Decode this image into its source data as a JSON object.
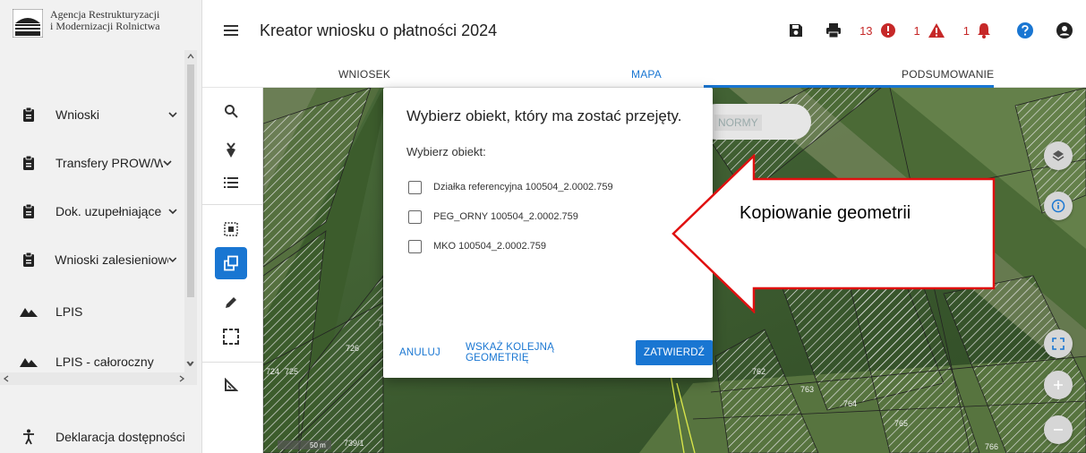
{
  "org": {
    "line1": "Agencja Restrukturyzacji",
    "line2": "i Modernizacji Rolnictwa",
    "badge": "ARiMR"
  },
  "sidebar": {
    "items": [
      {
        "label": "Wnioski",
        "icon": "clipboard-icon",
        "chevron": true
      },
      {
        "label": "Transfery PROW/WPR",
        "icon": "clipboard-icon",
        "chevron": true
      },
      {
        "label": "Dok. uzupełniające",
        "icon": "clipboard-icon",
        "chevron": true
      },
      {
        "label": "Wnioski zalesieniowe",
        "icon": "clipboard-icon",
        "chevron": true
      },
      {
        "label": "LPIS",
        "icon": "terrain-icon",
        "chevron": false
      },
      {
        "label": "LPIS - całoroczny",
        "icon": "terrain-icon",
        "chevron": false
      },
      {
        "label": "Deklaracja dostępności",
        "icon": "accessibility-icon",
        "chevron": false
      }
    ]
  },
  "header": {
    "title": "Kreator wniosku o płatności 2024",
    "counts": {
      "errors": "13",
      "warnings": "1",
      "notifications": "1"
    }
  },
  "tabs": [
    {
      "label": "WNIOSEK",
      "active": false
    },
    {
      "label": "MAPA",
      "active": true
    },
    {
      "label": "PODSUMOWANIE",
      "active": false
    }
  ],
  "map": {
    "normy_label": "NORMY",
    "scale": "50 m",
    "parcel_labels": [
      "726",
      "724",
      "725",
      "73",
      "739/1",
      "762",
      "763",
      "764",
      "765",
      "766"
    ]
  },
  "dialog": {
    "title": "Wybierz obiekt, który ma zostać przejęty.",
    "subtitle": "Wybierz obiekt:",
    "options": [
      {
        "label": "Działka referencyjna 100504_2.0002.759",
        "checked": false
      },
      {
        "label": "PEG_ORNY 100504_2.0002.759",
        "checked": false
      },
      {
        "label": "MKO 100504_2.0002.759",
        "checked": false
      }
    ],
    "cancel": "ANULUJ",
    "next": "WSKAŻ KOLEJNĄ GEOMETRIĘ",
    "confirm": "ZATWIERDŹ"
  },
  "callout": {
    "text": "Kopiowanie geometrii"
  },
  "colors": {
    "primary": "#1976d2",
    "error": "#c62828",
    "warning": "#c62828",
    "help": "#1976d2"
  }
}
